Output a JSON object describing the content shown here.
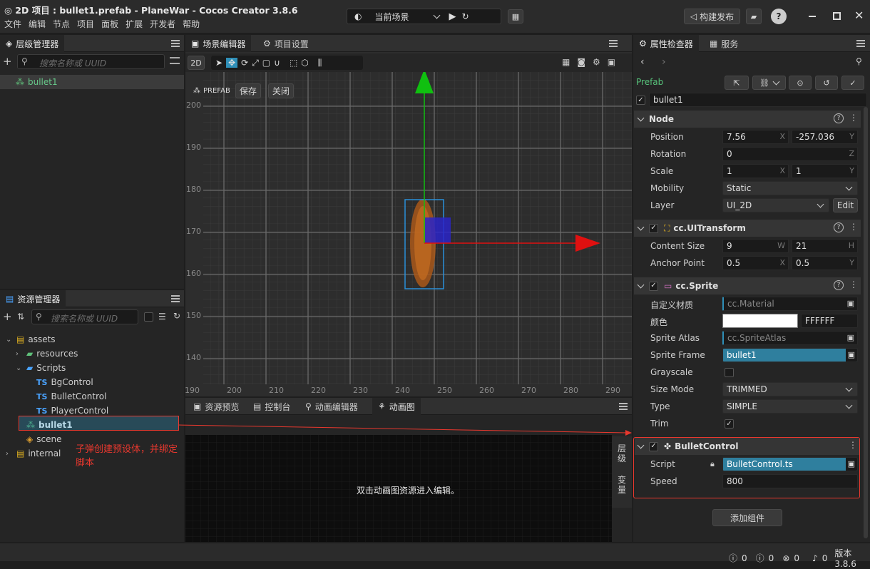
{
  "window": {
    "title": "2D 项目 : bullet1.prefab - PlaneWar - Cocos Creator 3.8.6",
    "scene_select": "当前场景",
    "build_button": "构建发布"
  },
  "menu": [
    "文件",
    "编辑",
    "节点",
    "项目",
    "面板",
    "扩展",
    "开发者",
    "帮助"
  ],
  "hierarchy": {
    "tab": "层级管理器",
    "search_placeholder": "搜索名称或 UUID",
    "root": "bullet1"
  },
  "scene": {
    "tab_editor": "场景编辑器",
    "tab_settings": "项目设置",
    "mode_2d": "2D",
    "prefab_label": "PREFAB",
    "save": "保存",
    "close": "关闭",
    "ruler_y": [
      "200",
      "190",
      "180",
      "170",
      "160",
      "150",
      "140"
    ],
    "ruler_x": [
      "190",
      "200",
      "210",
      "220",
      "230",
      "240",
      "250",
      "260",
      "270",
      "280",
      "290"
    ]
  },
  "assets": {
    "tab": "资源管理器",
    "search_placeholder": "搜索名称或 UUID",
    "tree": [
      {
        "label": "assets",
        "kind": "db",
        "depth": 0,
        "arrow": "v"
      },
      {
        "label": "resources",
        "kind": "folder-green",
        "depth": 1,
        "arrow": ">"
      },
      {
        "label": "Scripts",
        "kind": "folder-blue",
        "depth": 1,
        "arrow": "v"
      },
      {
        "label": "BgControl",
        "kind": "ts",
        "depth": 2,
        "arrow": ""
      },
      {
        "label": "BulletControl",
        "kind": "ts",
        "depth": 2,
        "arrow": ""
      },
      {
        "label": "PlayerControl",
        "kind": "ts",
        "depth": 2,
        "arrow": ""
      },
      {
        "label": "bullet1",
        "kind": "prefab",
        "depth": 1,
        "arrow": ""
      },
      {
        "label": "scene",
        "kind": "scene",
        "depth": 1,
        "arrow": ""
      },
      {
        "label": "internal",
        "kind": "db",
        "depth": 0,
        "arrow": ">"
      }
    ],
    "ts_badge": "TS"
  },
  "annotation": "子弹创建预设体，并绑定脚本",
  "bottom": {
    "tabs": [
      "资源预览",
      "控制台",
      "动画编辑器",
      "动画图"
    ],
    "hint": "双击动画图资源进入编辑。",
    "side_tabs": [
      "层级",
      "变量"
    ]
  },
  "inspector": {
    "tab": "属性检查器",
    "tab_service": "服务",
    "prefab_label": "Prefab",
    "node_name": "bullet1",
    "node_section": "Node",
    "position_label": "Position",
    "position_x": "7.56",
    "position_y": "-257.036",
    "rotation_label": "Rotation",
    "rotation": "0",
    "scale_label": "Scale",
    "scale_x": "1",
    "scale_y": "1",
    "mobility_label": "Mobility",
    "mobility": "Static",
    "layer_label": "Layer",
    "layer": "UI_2D",
    "edit": "Edit",
    "uitransform": "cc.UITransform",
    "content_size_label": "Content Size",
    "width": "9",
    "height": "21",
    "anchor_label": "Anchor Point",
    "anchor_x": "0.5",
    "anchor_y": "0.5",
    "sprite": "cc.Sprite",
    "custom_material_label": "自定义材质",
    "custom_material": "cc.Material",
    "color_label": "颜色",
    "color_hex": "FFFFFF",
    "sprite_atlas_label": "Sprite Atlas",
    "sprite_atlas": "cc.SpriteAtlas",
    "sprite_frame_label": "Sprite Frame",
    "sprite_frame": "bullet1",
    "grayscale_label": "Grayscale",
    "size_mode_label": "Size Mode",
    "size_mode": "TRIMMED",
    "type_label": "Type",
    "type": "SIMPLE",
    "trim_label": "Trim",
    "bullet_control": "BulletControl",
    "script_label": "Script",
    "script": "BulletControl.ts",
    "speed_label": "Speed",
    "speed": "800",
    "add_component": "添加组件",
    "axis": {
      "x": "X",
      "y": "Y",
      "z": "Z",
      "w": "W",
      "h": "H"
    }
  },
  "status": {
    "info": "0",
    "warn": "0",
    "error": "0",
    "notify": "0",
    "version": "版本3.8.6"
  },
  "colors": {
    "accent": "#2f8fb8",
    "annotation": "#e8382e",
    "gizmo_x": "#e01010",
    "gizmo_y": "#10c010"
  }
}
